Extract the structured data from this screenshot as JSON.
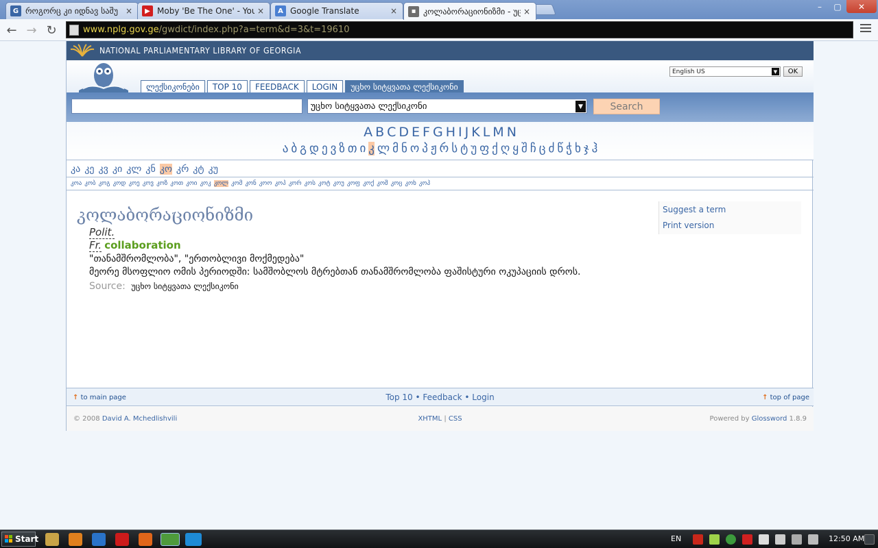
{
  "browser": {
    "tabs": [
      {
        "title": "როგორც კი იდნავ საშუ",
        "favicon": "G",
        "favicon_color": "#3a66a5",
        "active": false
      },
      {
        "title": "Moby 'Be The One' - YouTub",
        "favicon": "▶",
        "favicon_color": "#d21f1f",
        "active": false
      },
      {
        "title": "Google Translate",
        "favicon": "A",
        "favicon_color": "#4a7fd1",
        "active": false
      },
      {
        "title": "კოლაბორაციონიზმი - უც",
        "favicon": "▪",
        "favicon_color": "#6d6d6d",
        "active": true
      }
    ],
    "close_glyph": "×",
    "window_controls": {
      "minimize": "–",
      "maximize": "▢",
      "close": "✕"
    },
    "url_host": "www.nplg.gov.ge",
    "url_path": "/gwdict/index.php?a=term&d=3&t=19610"
  },
  "library": {
    "name": "NATIONAL PARLIAMENTARY LIBRARY OF GEORGIA"
  },
  "nav_tabs": [
    "ლექსიკონები",
    "TOP 10",
    "FEEDBACK",
    "LOGIN",
    "უცხო სიტყვათა ლექსიკონი"
  ],
  "language": {
    "selected": "English US",
    "ok_label": "OK"
  },
  "search": {
    "value": "",
    "dictionary": "უცხო სიტყვათა ლექსიკონი",
    "button": "Search"
  },
  "alphabet": {
    "latin": [
      "A",
      "B",
      "C",
      "D",
      "E",
      "F",
      "G",
      "H",
      "I",
      "J",
      "K",
      "L",
      "M",
      "N"
    ],
    "georgian": [
      "ა",
      "ბ",
      "გ",
      "დ",
      "ე",
      "ვ",
      "ზ",
      "თ",
      "ი",
      "კ",
      "ლ",
      "მ",
      "ნ",
      "ო",
      "პ",
      "ჟ",
      "რ",
      "ს",
      "ტ",
      "უ",
      "ფ",
      "ქ",
      "ღ",
      "ყ",
      "შ",
      "ჩ",
      "ც",
      "ძ",
      "წ",
      "ჭ",
      "ხ",
      "ჯ",
      "ჰ"
    ],
    "georgian_selected": "კ"
  },
  "sub_letters": {
    "level1": [
      "კა",
      "კე",
      "კვ",
      "კი",
      "კლ",
      "კნ",
      "კო",
      "კრ",
      "კტ",
      "კუ"
    ],
    "level1_selected": "კო",
    "level2": [
      "კოა",
      "კობ",
      "კოგ",
      "კოდ",
      "კოე",
      "კოვ",
      "კოზ",
      "კოთ",
      "კოი",
      "კოკ",
      "კოლ",
      "კომ",
      "კონ",
      "კოო",
      "კოპ",
      "კორ",
      "კოს",
      "კოტ",
      "კოუ",
      "კოფ",
      "კოქ",
      "კოშ",
      "კოც",
      "კოხ",
      "კოჰ"
    ],
    "level2_selected": "კოლ"
  },
  "entry": {
    "term": "კოლაბორაციონიზმი",
    "abbr": "Polit.",
    "lang_abbr": "Fr.",
    "translation": "collaboration",
    "definition_1": "\"თანამშრომლობა\", \"ერთობლივი მოქმედება\"",
    "definition_2": "მეორე მსოფლიო ომის პერიოდში: სამშობლოს მტრებთან თანამშრომლობა ფაშისტური ოკუპაციის დროს.",
    "source_label": "Source:",
    "source_value": "უცხო სიტყვათა ლექსიკონი"
  },
  "sidebar": {
    "suggest": "Suggest a term",
    "print": "Print version"
  },
  "footer": {
    "main_page": "to main page",
    "top10": "Top 10",
    "sep": "•",
    "feedback": "Feedback",
    "login": "Login",
    "top_of_page": "top of page",
    "copyright": "© 2008",
    "author": "David A. Mchedlishvili",
    "xhtml": "XHTML",
    "bar": "|",
    "css": "CSS",
    "powered": "Powered by",
    "glossword": "Glossword",
    "version": "1.8.9"
  },
  "taskbar": {
    "start": "Start",
    "lang": "EN",
    "time": "12:50 AM"
  }
}
